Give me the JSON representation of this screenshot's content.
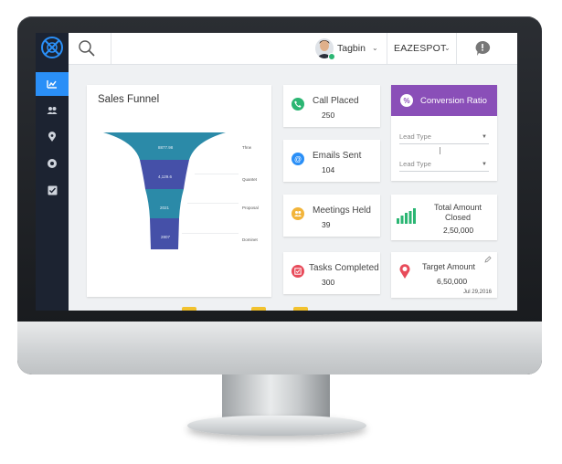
{
  "topbar": {
    "user_name": "Tagbin",
    "org_name": "EAZESPOT"
  },
  "sales_funnel": {
    "title": "Sales Funnel",
    "stages": [
      {
        "value": "8877.98",
        "label": "Thrw"
      },
      {
        "value": "4,129.6",
        "label": "Quantet"
      },
      {
        "value": "2021",
        "label": "Proposal"
      },
      {
        "value": "2807",
        "label": "Dominet"
      }
    ]
  },
  "stats": [
    {
      "title": "Call Placed",
      "value": "250",
      "color": "#2bb673",
      "icon": "phone-icon"
    },
    {
      "title": "Emails Sent",
      "value": "104",
      "color": "#2a8ff7",
      "icon": "at-icon"
    },
    {
      "title": "Meetings Held",
      "value": "39",
      "color": "#f2b43a",
      "icon": "people-icon"
    },
    {
      "title": "Tasks Completed",
      "value": "300",
      "color": "#e84b5a",
      "icon": "checkbox-icon"
    }
  ],
  "conversion": {
    "title": "Conversion Ratio",
    "select1_placeholder": "Lead Type",
    "select2_placeholder": "Lead Type",
    "color": "#8a4fb8"
  },
  "total_amount": {
    "title_line1": "Total Amount",
    "title_line2": "Closed",
    "value": "2,50,000",
    "color": "#2bb673"
  },
  "target_amount": {
    "title": "Target Amount",
    "value": "6,50,000",
    "date": "Jul 29,2016",
    "color": "#e84b5a"
  },
  "colors": {
    "sidebar": "#1c2331",
    "sidebar_active": "#2a8ff7",
    "funnel_teal": "#2b8aa8",
    "funnel_indigo": "#4550a8"
  }
}
